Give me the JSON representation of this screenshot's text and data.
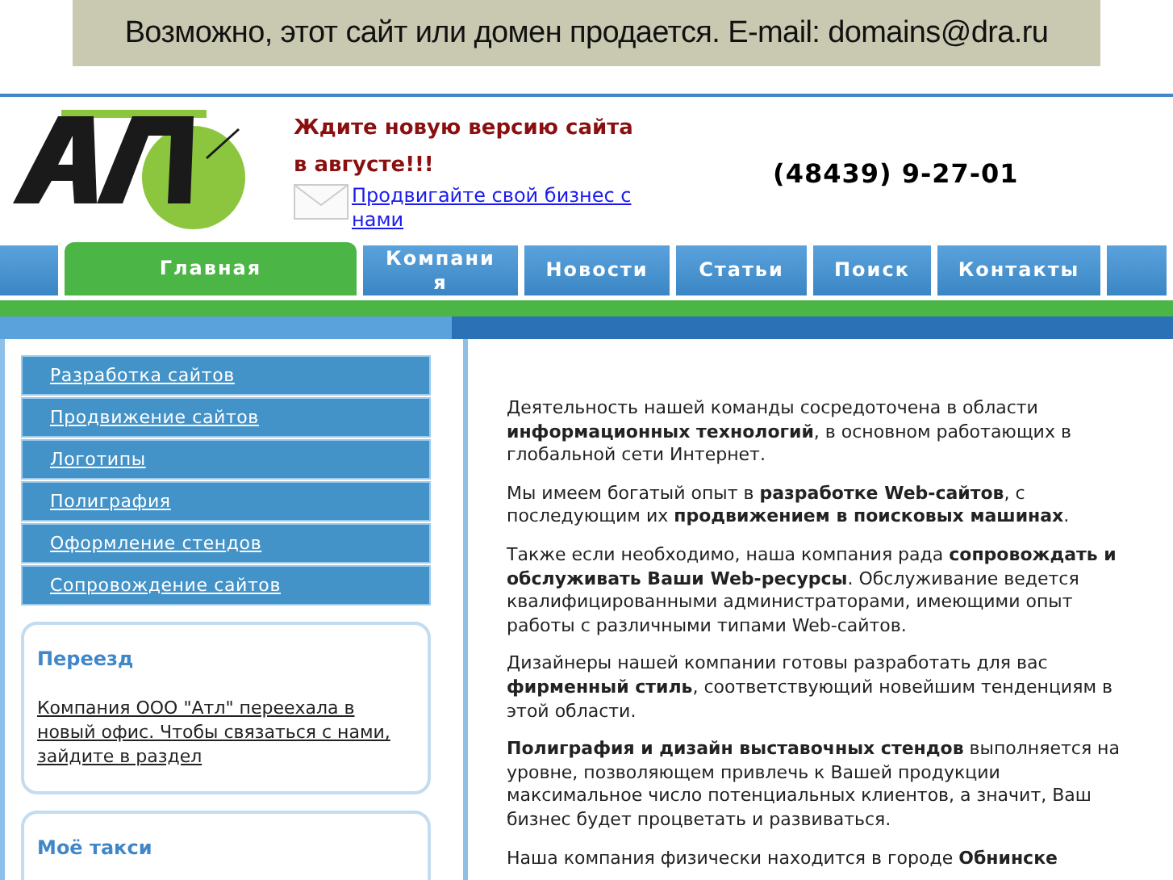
{
  "banner": {
    "text": "Возможно, этот сайт или домен продается. E-mail: domains@dra.ru"
  },
  "header": {
    "announcement": "Ждите новую версию сайта в августе!!!",
    "promo_link": "Продвигайте свой бизнес с нами",
    "phone": "(48439) 9-27-01"
  },
  "nav": [
    {
      "label": "Главная",
      "selected": true
    },
    {
      "label": "Компания",
      "selected": false
    },
    {
      "label": "Новости",
      "selected": false
    },
    {
      "label": "Статьи",
      "selected": false
    },
    {
      "label": "Поиск",
      "selected": false
    },
    {
      "label": "Контакты",
      "selected": false
    }
  ],
  "sidebar": {
    "menu": [
      "Разработка сайтов",
      "Продвижение сайтов",
      "Логотипы",
      "Полиграфия",
      "Оформление стендов",
      "Сопровождение сайтов"
    ],
    "boxes": [
      {
        "title": "Переезд",
        "text": "Компания ООО \"Атл\" переехала в новый офис. Чтобы связаться с нами, зайдите в раздел"
      },
      {
        "title": "Моё такси"
      }
    ]
  },
  "content": {
    "paragraphs": [
      "Деятельность нашей команды сосредоточена в области **информационных технологий**, в основном работающих в глобальной сети Интернет.",
      "Мы имеем богатый опыт в **разработке Web-сайтов**, с последующим их **продвижением в поисковых машинах**.",
      "Также если необходимо, наша компания рада **сопровождать и обслуживать Ваши Web-ресурсы**. Обслуживание ведется квалифицированными администраторами, имеющими опыт работы с различными типами Web-сайтов.",
      "Дизайнеры нашей компании готовы разработать для вас **фирменный стиль**, соответствующий новейшим тенденциям в этой области.",
      "**Полиграфия и дизайн выставочных стендов** выполняется на уровне, позволяющем привлечь к Вашей продукции максимальное число потенциальных клиентов, а значит, Ваш бизнес будет процветать и развиваться.",
      "Наша компания физически находится в городе **Обнинске**"
    ]
  }
}
